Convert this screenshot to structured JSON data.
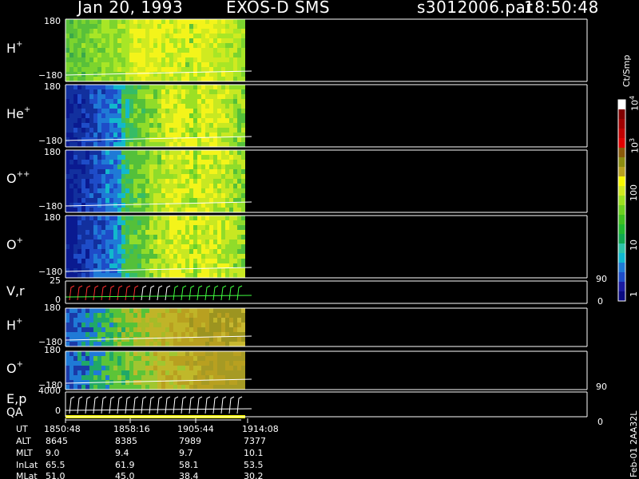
{
  "header": {
    "date": "Jan 20, 1993",
    "instrument": "EXOS-D SMS",
    "file": "s3012006.par",
    "time": "18:50:48"
  },
  "colorbar": {
    "unit": "Ct/Smp",
    "tick_labels": [
      "1",
      "10",
      "100",
      "10",
      "10"
    ],
    "tick_exponents": [
      "",
      "",
      "",
      "3",
      "4"
    ],
    "colors": [
      "#0a0a80",
      "#1a1aa0",
      "#1e4cc8",
      "#1f7ad6",
      "#10b8d0",
      "#2ec4a8",
      "#10a850",
      "#20b830",
      "#40c020",
      "#6cd020",
      "#9ce020",
      "#d0e820",
      "#f8f800",
      "#b8a020",
      "#8c8c10",
      "#8a5a0a",
      "#e00000",
      "#c00000",
      "#a00000",
      "#800000",
      "#ffffff"
    ]
  },
  "panels": [
    {
      "species": "H",
      "charge": "+",
      "ytop": "180",
      "ybot": "−180"
    },
    {
      "species": "He",
      "charge": "+",
      "ytop": "180",
      "ybot": "−180"
    },
    {
      "species": "O",
      "charge": "++",
      "ytop": "180",
      "ybot": "−180"
    },
    {
      "species": "O",
      "charge": "+",
      "ytop": "180",
      "ybot": "−180"
    },
    {
      "species": "V,r",
      "charge": "",
      "ytop": "25",
      "ybot": "0",
      "rtop": "90",
      "rbot": "0"
    },
    {
      "species": "H",
      "charge": "+",
      "ytop": "180",
      "ybot": "−180"
    },
    {
      "species": "O",
      "charge": "+",
      "ytop": "180",
      "ybot": "−180"
    },
    {
      "species": "E,p",
      "charge": "",
      "ytop": "4000",
      "ybot": "0",
      "rtop": "90",
      "rbot": "0"
    }
  ],
  "qa_label": "QA",
  "side_label": "Feb-01 2AA32L",
  "orbit": {
    "row_labels": [
      "UT",
      "ALT",
      "MLT",
      "InLat",
      "MLat"
    ],
    "columns": [
      {
        "UT": "1850:48",
        "ALT": "8645",
        "MLT": "9.0",
        "InLat": "65.5",
        "MLat": "51.0"
      },
      {
        "UT": "1858:16",
        "ALT": "8385",
        "MLT": "9.4",
        "InLat": "61.9",
        "MLat": "45.0"
      },
      {
        "UT": "1905:44",
        "ALT": "7989",
        "MLT": "9.7",
        "InLat": "58.1",
        "MLat": "38.4"
      },
      {
        "UT": "1914:08",
        "ALT": "7377",
        "MLT": "10.1",
        "InLat": "53.5",
        "MLat": "30.2"
      }
    ]
  },
  "chart_data": {
    "type": "heatmap",
    "title": "Jan 20, 1993   EXOS-D SMS",
    "panels": [
      {
        "name": "H+",
        "ylim": [
          -180,
          180
        ]
      },
      {
        "name": "He+",
        "ylim": [
          -180,
          180
        ]
      },
      {
        "name": "O++",
        "ylim": [
          -180,
          180
        ]
      },
      {
        "name": "O+",
        "ylim": [
          -180,
          180
        ]
      },
      {
        "name": "V,r",
        "ylim": [
          0,
          25
        ]
      },
      {
        "name": "H+",
        "ylim": [
          -180,
          180
        ]
      },
      {
        "name": "O+",
        "ylim": [
          -180,
          180
        ]
      },
      {
        "name": "E,p",
        "ylim": [
          0,
          4000
        ]
      }
    ],
    "x_ticks": [
      "1850:48",
      "1858:16",
      "1905:44",
      "1914:08"
    ],
    "colorbar": {
      "unit": "Ct/Smp",
      "scale": "log",
      "range": [
        1,
        10000
      ]
    }
  }
}
